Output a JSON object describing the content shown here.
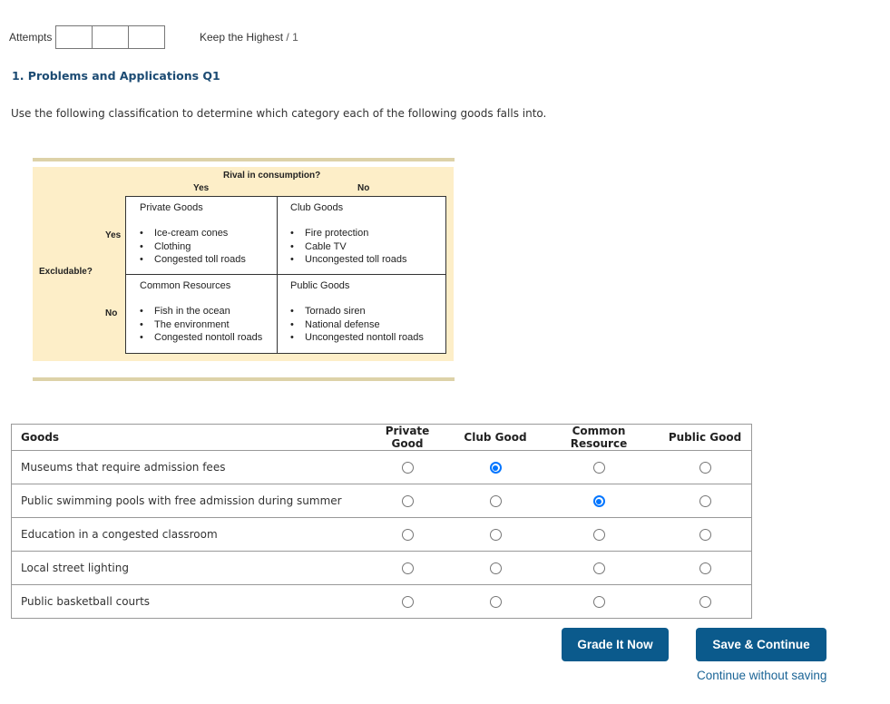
{
  "header": {
    "attempts_label": "Attempts",
    "attempt_boxes": 3,
    "keep_label": "Keep the Highest",
    "keep_denominator": "/ 1"
  },
  "question": {
    "title": "1. Problems and Applications Q1",
    "instructions": "Use the following classification to determine which category each of the following goods falls into."
  },
  "figure": {
    "col_header": "Rival in consumption?",
    "col_yes": "Yes",
    "col_no": "No",
    "row_header": "Excludable?",
    "row_yes": "Yes",
    "row_no": "No",
    "cells": [
      {
        "title": "Private Goods",
        "items": [
          "Ice-cream cones",
          "Clothing",
          "Congested toll roads"
        ]
      },
      {
        "title": "Club Goods",
        "items": [
          "Fire protection",
          "Cable TV",
          "Uncongested toll roads"
        ]
      },
      {
        "title": "Common Resources",
        "items": [
          "Fish in the ocean",
          "The environment",
          "Congested nontoll roads"
        ]
      },
      {
        "title": "Public Goods",
        "items": [
          "Tornado siren",
          "National defense",
          "Uncongested nontoll roads"
        ]
      }
    ]
  },
  "matrix": {
    "goods_header": "Goods",
    "columns": [
      "Private Good",
      "Club Good",
      "Common Resource",
      "Public Good"
    ],
    "rows": [
      {
        "label": "Museums that require admission fees",
        "selected": "Club Good"
      },
      {
        "label": "Public swimming pools with free admission during summer",
        "selected": "Common Resource"
      },
      {
        "label": "Education in a congested classroom",
        "selected": null
      },
      {
        "label": "Local street lighting",
        "selected": null
      },
      {
        "label": "Public basketball courts",
        "selected": null
      }
    ]
  },
  "actions": {
    "grade_label": "Grade It Now",
    "save_label": "Save & Continue",
    "continue_link": "Continue without saving"
  },
  "colors": {
    "title_blue": "#1c4b73",
    "button_blue": "#0b5a8c",
    "radio_checked": "#0075ff",
    "figure_bg": "#fdeec8",
    "figure_rule": "#ddd2a8"
  }
}
